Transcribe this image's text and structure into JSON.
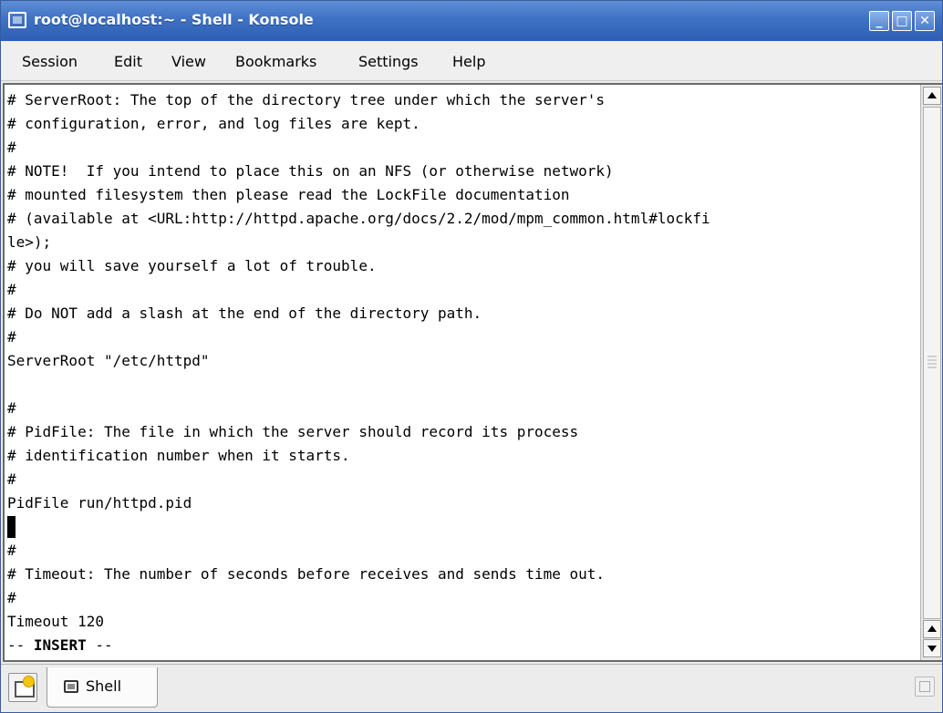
{
  "window": {
    "title": "root@localhost:~ - Shell - Konsole",
    "controls": [
      "minimize",
      "maximize",
      "close"
    ]
  },
  "menu": {
    "session": "Session",
    "edit": "Edit",
    "view": "View",
    "bookmarks": "Bookmarks",
    "settings": "Settings",
    "help": "Help"
  },
  "terminal": {
    "lines": [
      "# ServerRoot: The top of the directory tree under which the server's",
      "# configuration, error, and log files are kept.",
      "#",
      "# NOTE!  If you intend to place this on an NFS (or otherwise network)",
      "# mounted filesystem then please read the LockFile documentation",
      "# (available at <URL:http://httpd.apache.org/docs/2.2/mod/mpm_common.html#lockfi",
      "le>);",
      "# you will save yourself a lot of trouble.",
      "#",
      "# Do NOT add a slash at the end of the directory path.",
      "#",
      "ServerRoot \"/etc/httpd\"",
      "",
      "#",
      "# PidFile: The file in which the server should record its process",
      "# identification number when it starts.",
      "#",
      "PidFile run/httpd.pid",
      "",
      "#",
      "# Timeout: The number of seconds before receives and sends time out.",
      "#",
      "Timeout 120"
    ],
    "status_prefix": "-- ",
    "status_mode": "INSERT",
    "status_suffix": " --"
  },
  "tabs": {
    "active_label": "Shell"
  }
}
